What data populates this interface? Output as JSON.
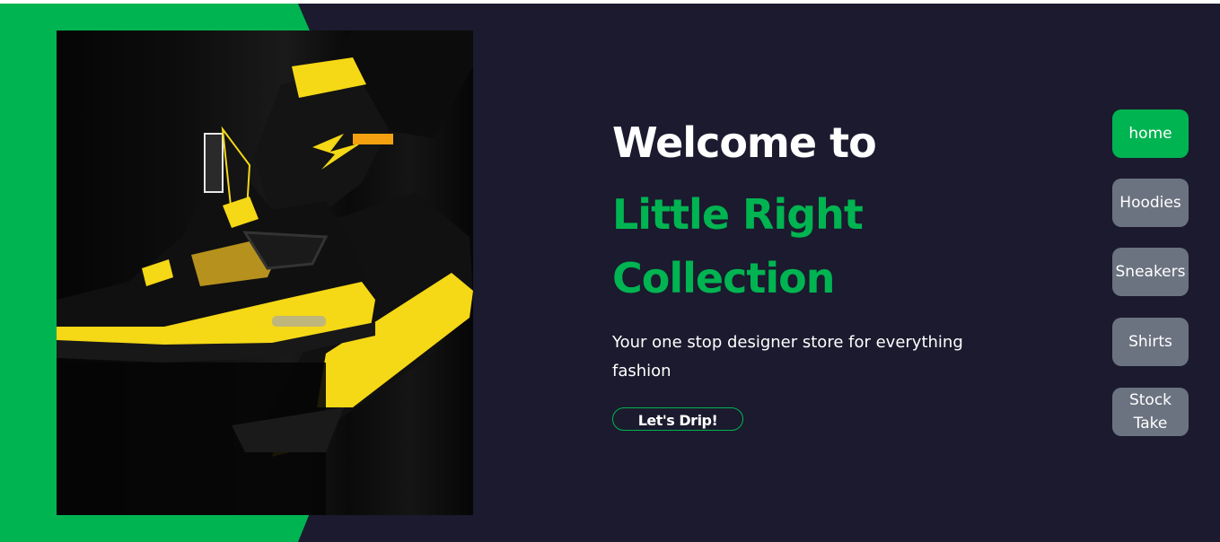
{
  "hero": {
    "welcome": "Welcome to",
    "brand": "Little Right Collection",
    "tagline": "Your one stop designer store for everything fashion",
    "cta_label": "Let's Drip!"
  },
  "nav": {
    "items": [
      {
        "label": "home",
        "active": true
      },
      {
        "label": "Hoodies",
        "active": false
      },
      {
        "label": "Sneakers",
        "active": false
      },
      {
        "label": "Shirts",
        "active": false
      },
      {
        "label": "Stock Take",
        "active": false
      }
    ]
  },
  "colors": {
    "background": "#1b1a2e",
    "accent": "#00b451",
    "nav_inactive": "#6b7380",
    "sneaker_yellow": "#f5d816"
  },
  "image": {
    "subject": "sneaker-photo"
  }
}
